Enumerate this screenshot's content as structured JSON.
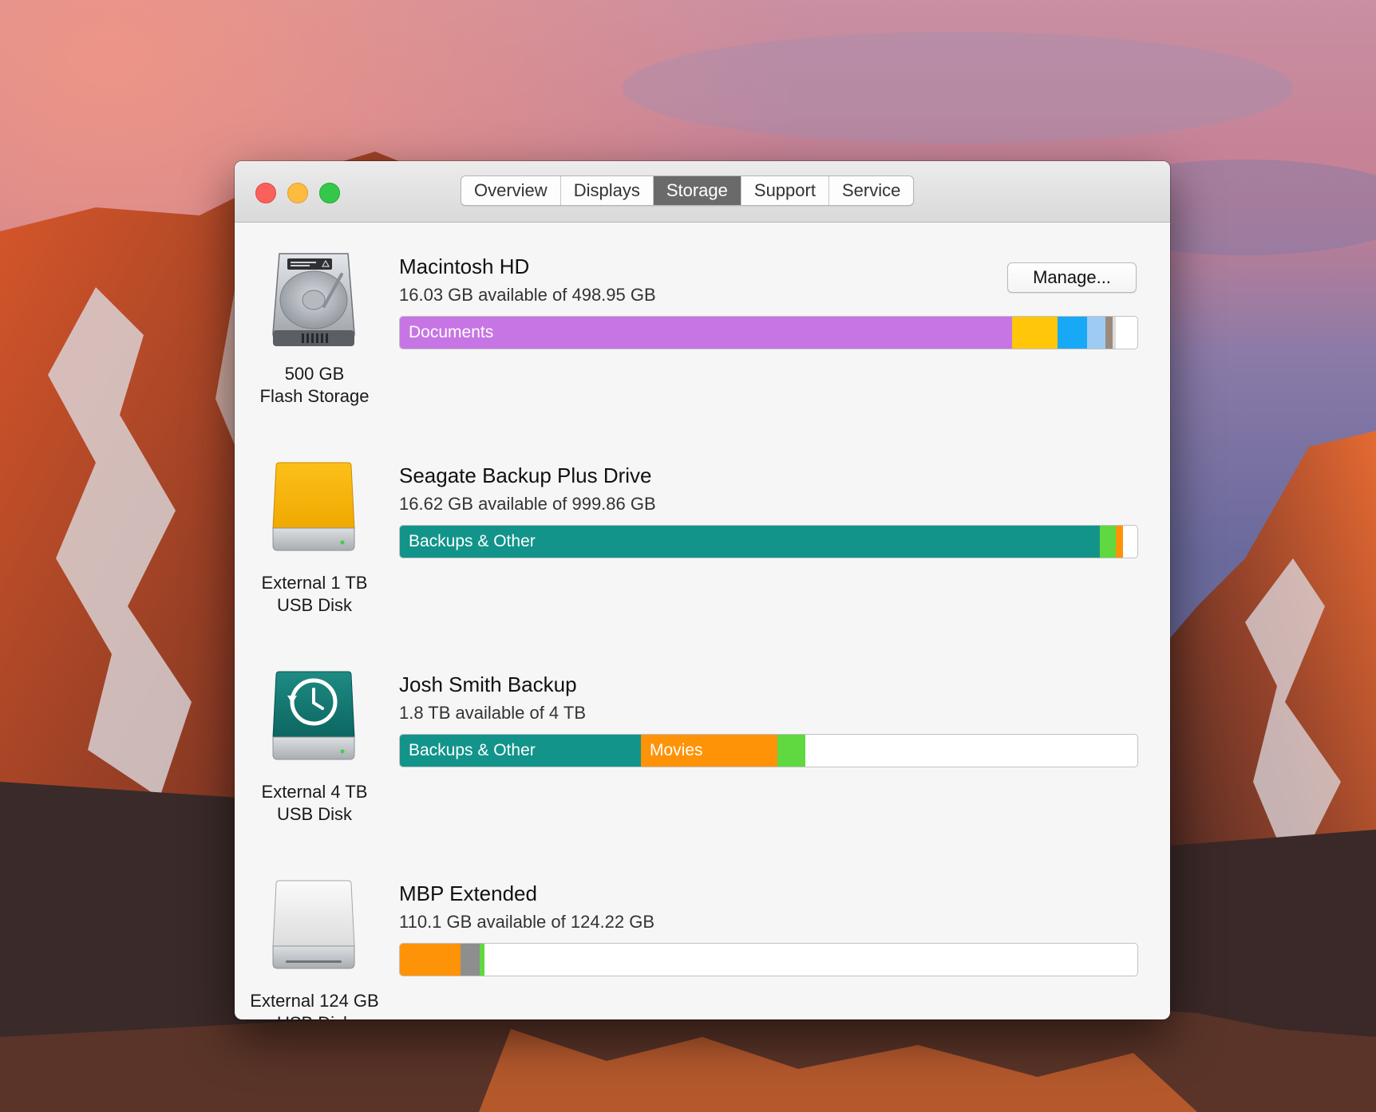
{
  "window": {
    "tabs": [
      {
        "label": "Overview"
      },
      {
        "label": "Displays"
      },
      {
        "label": "Storage"
      },
      {
        "label": "Support"
      },
      {
        "label": "Service"
      }
    ],
    "active_tab": "Storage"
  },
  "colors": {
    "documents": "#c775e4",
    "apps": "#ffc60a",
    "photos": "#17a9f5",
    "light_blue": "#9ecbf3",
    "system": "#9c8a7d",
    "backups": "#12948a",
    "green": "#5fd93f",
    "movies": "#fe9307",
    "gray": "#8e8e8e",
    "free": "#ffffff"
  },
  "disks": [
    {
      "name": "Macintosh HD",
      "available": "16.03 GB available of 498.95 GB",
      "caption": [
        "500 GB",
        "Flash Storage"
      ],
      "icon": "internal-hard-drive-icon",
      "button": "Manage...",
      "segments": [
        {
          "label": "Documents",
          "color": "#c775e4",
          "fraction": 0.83
        },
        {
          "label": "",
          "color": "#ffc60a",
          "fraction": 0.062
        },
        {
          "label": "",
          "color": "#17a9f5",
          "fraction": 0.04
        },
        {
          "label": "",
          "color": "#9ecbf3",
          "fraction": 0.025
        },
        {
          "label": "",
          "color": "#9c8a7d",
          "fraction": 0.01
        },
        {
          "label": "",
          "color": "#dcdcdc",
          "fraction": 0.004
        }
      ]
    },
    {
      "name": "Seagate Backup Plus Drive",
      "available": "16.62 GB available of 999.86 GB",
      "caption": [
        "External 1 TB",
        "USB Disk"
      ],
      "icon": "external-yellow-drive-icon",
      "segments": [
        {
          "label": "Backups & Other",
          "color": "#12948a",
          "fraction": 0.949
        },
        {
          "label": "",
          "color": "#5fd93f",
          "fraction": 0.022
        },
        {
          "label": "",
          "color": "#fe9307",
          "fraction": 0.01
        }
      ]
    },
    {
      "name": "Josh Smith Backup",
      "available": "1.8 TB available of 4 TB",
      "caption": [
        "External 4 TB",
        "USB Disk"
      ],
      "icon": "time-machine-drive-icon",
      "segments": [
        {
          "label": "Backups & Other",
          "color": "#12948a",
          "fraction": 0.327
        },
        {
          "label": "Movies",
          "color": "#fe9307",
          "fraction": 0.185
        },
        {
          "label": "",
          "color": "#5fd93f",
          "fraction": 0.038
        }
      ]
    },
    {
      "name": "MBP Extended",
      "available": "110.1 GB available of 124.22 GB",
      "caption": [
        "External 124 GB",
        "USB Disk"
      ],
      "icon": "external-white-drive-icon",
      "segments": [
        {
          "label": "",
          "color": "#fe9307",
          "fraction": 0.082
        },
        {
          "label": "",
          "color": "#8e8e8e",
          "fraction": 0.026
        },
        {
          "label": "",
          "color": "#5fd93f",
          "fraction": 0.006
        }
      ]
    }
  ]
}
